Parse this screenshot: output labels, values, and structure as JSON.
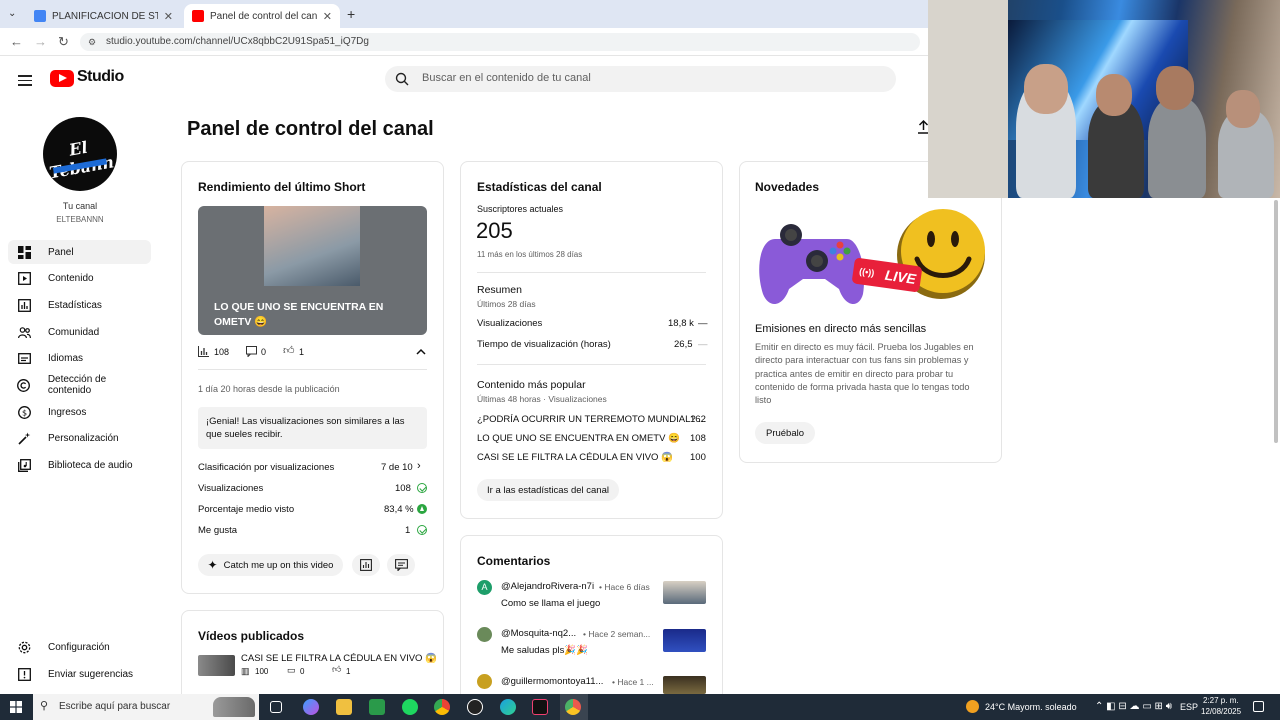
{
  "browser": {
    "tabs": [
      {
        "title": "PLANIFICACION DE STREAMS -",
        "close": "✕"
      },
      {
        "title": "Panel de control del canal - Yo",
        "close": "✕"
      }
    ],
    "new_tab": "+",
    "url": "studio.youtube.com/channel/UCx8qbbC2U91Spa51_iQ7Dg"
  },
  "header": {
    "logo_text": "Studio",
    "search_placeholder": "Buscar en el contenido de tu canal"
  },
  "sidebar": {
    "channel_label": "Tu canal",
    "channel_name": "ELTEBANNN",
    "avatar_text": "El Tebann",
    "items": [
      {
        "label": "Panel",
        "icon": "dashboard-icon"
      },
      {
        "label": "Contenido",
        "icon": "content-icon"
      },
      {
        "label": "Estadísticas",
        "icon": "analytics-icon"
      },
      {
        "label": "Comunidad",
        "icon": "community-icon"
      },
      {
        "label": "Idiomas",
        "icon": "subtitles-icon"
      },
      {
        "label": "Detección de contenido",
        "icon": "copyright-icon"
      },
      {
        "label": "Ingresos",
        "icon": "earn-icon"
      },
      {
        "label": "Personalización",
        "icon": "customization-icon"
      },
      {
        "label": "Biblioteca de audio",
        "icon": "audio-library-icon"
      }
    ],
    "bottom": [
      {
        "label": "Configuración",
        "icon": "settings-icon"
      },
      {
        "label": "Enviar sugerencias",
        "icon": "feedback-icon"
      }
    ]
  },
  "page_title": "Panel de control del canal",
  "short_card": {
    "title": "Rendimiento del último Short",
    "thumb_caption": "LO QUE UNO SE ENCUENTRA EN OMETV 😄",
    "views": "108",
    "comments": "0",
    "likes": "1",
    "since": "1 día 20 horas desde la publicación",
    "note": "¡Genial! Las visualizaciones son similares a las que sueles recibir.",
    "rows": [
      {
        "label": "Clasificación por visualizaciones",
        "value": "7 de 10"
      },
      {
        "label": "Visualizaciones",
        "value": "108"
      },
      {
        "label": "Porcentaje medio visto",
        "value": "83,4 %"
      },
      {
        "label": "Me gusta",
        "value": "1"
      }
    ],
    "catch_up": "Catch me up on this video"
  },
  "videos_card": {
    "title": "Vídeos publicados",
    "video_title": "CASI SE LE FILTRA LA CÉDULA EN VIVO 😱",
    "views": "100",
    "comments": "0",
    "likes": "1"
  },
  "stats_card": {
    "title": "Estadísticas del canal",
    "subs_label": "Suscriptores actuales",
    "subs_value": "205",
    "subs_delta": "11 más en los últimos 28 días",
    "summary_title": "Resumen",
    "summary_period": "Últimos 28 días",
    "summary_rows": [
      {
        "label": "Visualizaciones",
        "value": "18,8 k",
        "trend": "—"
      },
      {
        "label": "Tiempo de visualización (horas)",
        "value": "26,5",
        "trend": "—"
      }
    ],
    "popular_title": "Contenido más popular",
    "popular_period": "Últimas 48 horas · Visualizaciones",
    "popular_rows": [
      {
        "label": "¿PODRÍA OCURRIR UN TERREMOTO MUNDIAL? ...",
        "value": "162"
      },
      {
        "label": "LO QUE UNO SE ENCUENTRA EN OMETV 😄",
        "value": "108"
      },
      {
        "label": "CASI SE LE FILTRA LA CÉDULA EN VIVO 😱",
        "value": "100"
      }
    ],
    "cta": "Ir a las estadísticas del canal"
  },
  "comments_card": {
    "title": "Comentarios",
    "items": [
      {
        "author": "@AlejandroRivera-n7i",
        "time": "• Hace 6 días",
        "text": "Como se llama el juego",
        "avatar_letter": "A",
        "avatar_color": "#1e9e6a"
      },
      {
        "author": "@Mosquita-nq2...",
        "time": "• Hace 2 seman...",
        "text": "Me saludas pls🎉🎉",
        "avatar_letter": "",
        "avatar_color": "#6a8a5a"
      },
      {
        "author": "@guillermomontoya11...",
        "time": "• Hace 1 ...",
        "text": "",
        "avatar_letter": "",
        "avatar_color": "#c8a020"
      }
    ]
  },
  "news_card": {
    "title": "Novedades",
    "live_badge": "LIVE",
    "headline": "Emisiones en directo más sencillas",
    "body": "Emitir en directo es muy fácil. Prueba los Jugables en directo para interactuar con tus fans sin problemas y practica antes de emitir en directo para probar tu contenido de forma privada hasta que lo tengas todo listo",
    "cta": "Pruébalo"
  },
  "taskbar": {
    "search_placeholder": "Escribe aquí para buscar",
    "weather": "24°C  Mayorm. soleado",
    "lang": "ESP",
    "time": "2:27 p. m.",
    "date": "12/08/2025"
  }
}
